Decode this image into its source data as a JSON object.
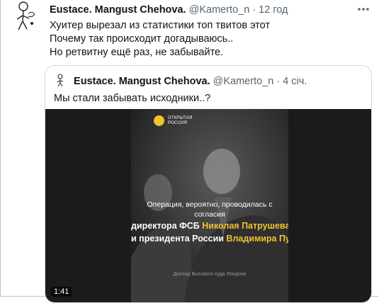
{
  "tweet": {
    "author_name": "Eustace. Mangust Chehova.",
    "handle": "@Kamerto_n",
    "separator": "·",
    "time": "12 год",
    "text": "Хуитер вырезал из статистики топ твитов этот\nПочему так происходит догадываюсь..\nНо ретвитну ещё раз, не забывайте."
  },
  "quoted": {
    "author_name": "Eustace. Mangust Chehova.",
    "handle": "@Kamerto_n",
    "separator": "·",
    "time": "4 січ.",
    "text": "Мы стали забывать исходники..?",
    "video": {
      "logo_line1": "ОТКРЫТАЯ",
      "logo_line2": "РОССИЯ",
      "caption_line1": "Операция, вероятно, проводилась с согласия",
      "caption_line2_prefix": "директора ФСБ ",
      "caption_line2_highlight": "Николая Патрушева",
      "caption_line3_prefix": "и президента России ",
      "caption_line3_highlight": "Владимира Путина",
      "caption_line3_suffix": "*",
      "footnote": "Доклад Высокого суда Лондона",
      "duration": "1:41"
    }
  },
  "icons": {
    "more": "more-horizontal-icon",
    "avatar": "avatar-sketch-icon"
  },
  "colors": {
    "highlight": "#f2c230",
    "muted": "#536471",
    "border": "#cfd9de"
  }
}
